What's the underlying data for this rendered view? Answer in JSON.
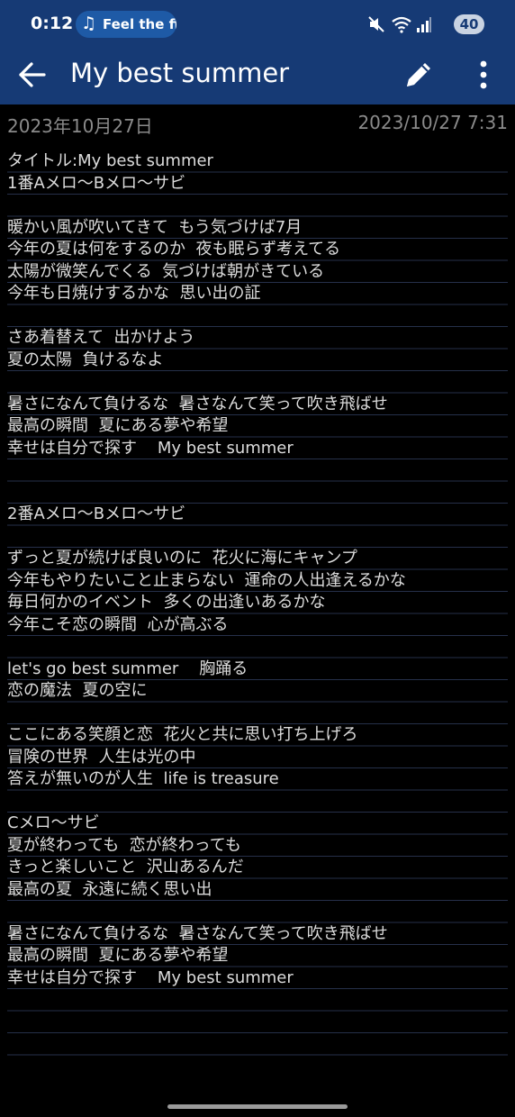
{
  "status_bar": {
    "time": "0:12",
    "media_text": "Feel the fi",
    "battery": "40"
  },
  "app_bar": {
    "title": "My best summer",
    "back_icon": "arrow-left-icon",
    "edit_icon": "pencil-icon",
    "more_icon": "more-vert-icon"
  },
  "note": {
    "date_created": "2023年10月27日",
    "date_modified": "2023/10/27 7:31",
    "lines": [
      "タイトル:My best summer",
      "1番Aメロ〜Bメロ〜サビ",
      "",
      "暖かい風が吹いてきて  もう気づけば7月",
      "今年の夏は何をするのか  夜も眠らず考えてる",
      "太陽が微笑んでくる  気づけば朝がきている",
      "今年も日焼けするかな  思い出の証",
      "",
      "さあ着替えて  出かけよう",
      "夏の太陽  負けるなよ",
      "",
      "暑さになんて負けるな  暑さなんて笑って吹き飛ばせ",
      "最高の瞬間  夏にある夢や希望",
      "幸せは自分で探す    My best summer",
      "",
      "",
      "2番Aメロ〜Bメロ〜サビ",
      "",
      "ずっと夏が続けば良いのに  花火に海にキャンプ",
      "今年もやりたいこと止まらない  運命の人出逢えるかな",
      "毎日何かのイベント  多くの出逢いあるかな",
      "今年こそ恋の瞬間  心が高ぶる",
      "",
      "let's go best summer    胸踊る",
      "恋の魔法  夏の空に",
      "",
      "ここにある笑顔と恋  花火と共に思い打ち上げろ",
      "冒険の世界  人生は光の中",
      "答えが無いのが人生  life is treasure",
      "",
      "Cメロ〜サビ",
      "夏が終わっても  恋が終わっても",
      "きっと楽しいこと  沢山あるんだ",
      "最高の夏  永遠に続く思い出",
      "",
      "暑さになんて負けるな  暑さなんて笑って吹き飛ばせ",
      "最高の瞬間  夏にある夢や希望",
      "幸せは自分で探す    My best summer"
    ]
  },
  "colors": {
    "app_bar": "#163a75",
    "background": "#000000",
    "text": "#dcdcdc",
    "date_text": "#8a8a8a",
    "rule_line": "#26304a"
  }
}
